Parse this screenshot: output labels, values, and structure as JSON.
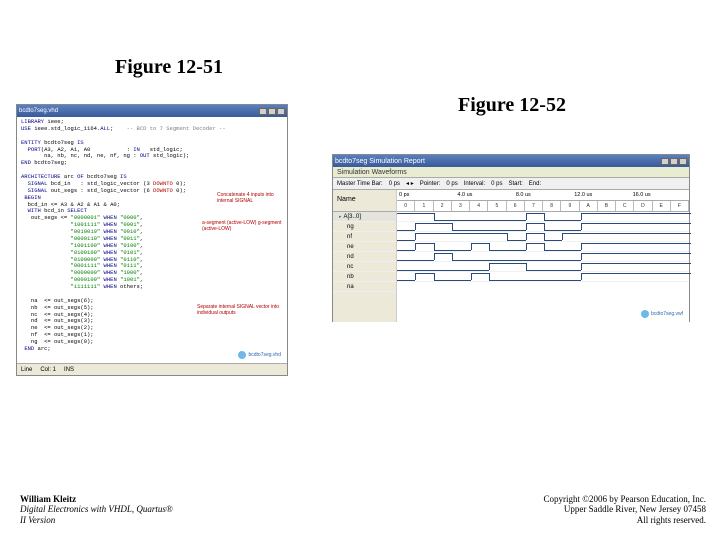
{
  "figure1": {
    "label": "Figure 12-51"
  },
  "figure2": {
    "label": "Figure 12-52"
  },
  "left_window": {
    "title": "bcdto7seg.vhd",
    "status": {
      "line": "Line",
      "col": "Col: 1",
      "mode": "INS"
    },
    "badge": "bcdto7seg.vhd",
    "annotations": {
      "a1": "Concatenate 4 inputs\ninto internal SIGNAL",
      "a2": "a-segment (active-LOW)\ng-segment (active-LOW)",
      "a3": "Separate internal SIGNAL vector\ninto individual outputs"
    },
    "code_lines": [
      "LIBRARY ieee;",
      "USE ieee.std_logic_1164.ALL;    -- BCD to 7 Segment Decoder --",
      "",
      "ENTITY bcdto7seg IS",
      "  PORT(A3, A2, A1, A0           : IN   std_logic;",
      "       na, nb, nc, nd, ne, nf, ng : OUT std_logic);",
      "END bcdto7seg;",
      "",
      "ARCHITECTURE arc OF bcdto7seg IS",
      "  SIGNAL bcd_in   : std_logic_vector (3 DOWNTO 0);",
      "  SIGNAL out_segs : std_logic_vector (6 DOWNTO 0);",
      " BEGIN",
      "  bcd_in <= A3 & A2 & A1 & A0;",
      "  WITH bcd_in SELECT",
      "   out_segs <= \"0000001\" WHEN \"0000\",",
      "               \"1001111\" WHEN \"0001\",",
      "               \"0010010\" WHEN \"0010\",",
      "               \"0000110\" WHEN \"0011\",",
      "               \"1001100\" WHEN \"0100\",",
      "               \"0100100\" WHEN \"0101\",",
      "               \"0100000\" WHEN \"0110\",",
      "               \"0001111\" WHEN \"0111\",",
      "               \"0000000\" WHEN \"1000\",",
      "               \"0000100\" WHEN \"1001\",",
      "               \"1111111\" WHEN others;",
      "",
      "   na  <= out_segs(6);",
      "   nb  <= out_segs(5);",
      "   nc  <= out_segs(4);",
      "   nd  <= out_segs(3);",
      "   ne  <= out_segs(2);",
      "   nf  <= out_segs(1);",
      "   ng  <= out_segs(0);",
      " END arc;"
    ]
  },
  "right_window": {
    "title": "bcdto7seg Simulation Report",
    "subheader": "Simulation Waveforms",
    "info": {
      "master": "Master Time Bar:",
      "master_v": "0 ps",
      "pointer": "Pointer:",
      "pointer_v": "0 ps",
      "interval": "Interval:",
      "interval_v": "0 ps",
      "start": "Start:",
      "end": "End:"
    },
    "time_ticks": [
      "0 ps",
      "4.0 us",
      "8.0 us",
      "12.0 us",
      "16.0 us"
    ],
    "name_col": "Name",
    "bus_name": "A[3..0]",
    "bus_values": [
      "0",
      "1",
      "2",
      "3",
      "4",
      "5",
      "6",
      "7",
      "8",
      "9",
      "A",
      "B",
      "C",
      "D",
      "E",
      "F"
    ],
    "signals": [
      "ng",
      "nf",
      "ne",
      "nd",
      "nc",
      "nb",
      "na"
    ],
    "badge": "bcdto7seg.vwf"
  },
  "footer": {
    "author": "William Kleitz",
    "book_line1": "Digital Electronics with VHDL, Quartus®",
    "book_line2": "II Version",
    "copyright1": "Copyright ©2006 by Pearson Education, Inc.",
    "copyright2": "Upper Saddle River, New Jersey 07458",
    "copyright3": "All rights reserved."
  }
}
